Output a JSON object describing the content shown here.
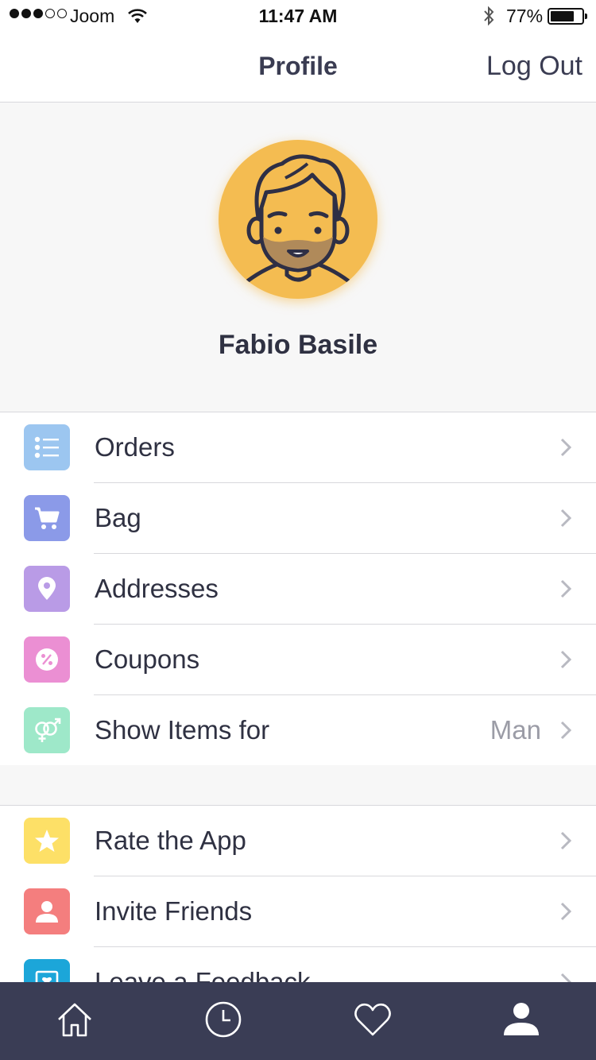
{
  "status_bar": {
    "carrier": "Joom",
    "time": "11:47 AM",
    "battery_percent": "77%",
    "battery_level": 0.77,
    "signal_bars": 3,
    "signal_total": 5
  },
  "nav": {
    "title": "Profile",
    "logout_label": "Log Out"
  },
  "profile": {
    "name": "Fabio Basile",
    "avatar_color": "#f4bc51"
  },
  "menu_primary": [
    {
      "label": "Orders",
      "icon": "list-icon",
      "color": "#9cc6f0"
    },
    {
      "label": "Bag",
      "icon": "cart-icon",
      "color": "#8b9ae8"
    },
    {
      "label": "Addresses",
      "icon": "location-pin-icon",
      "color": "#b99be6"
    },
    {
      "label": "Coupons",
      "icon": "percent-icon",
      "color": "#eb8fd3"
    },
    {
      "label": "Show Items for",
      "value": "Man",
      "icon": "gender-icon",
      "color": "#9ee8c9"
    }
  ],
  "menu_secondary": [
    {
      "label": "Rate the App",
      "icon": "star-icon",
      "color": "#fde067"
    },
    {
      "label": "Invite Friends",
      "icon": "person-icon",
      "color": "#f47e7e"
    },
    {
      "label": "Leave a Feedback",
      "icon": "feedback-icon",
      "color": "#1ca6d9"
    }
  ],
  "tabbar": [
    {
      "name": "home",
      "icon": "home-icon"
    },
    {
      "name": "history",
      "icon": "clock-icon"
    },
    {
      "name": "favorites",
      "icon": "heart-icon"
    },
    {
      "name": "profile",
      "icon": "profile-icon",
      "active": true
    }
  ]
}
